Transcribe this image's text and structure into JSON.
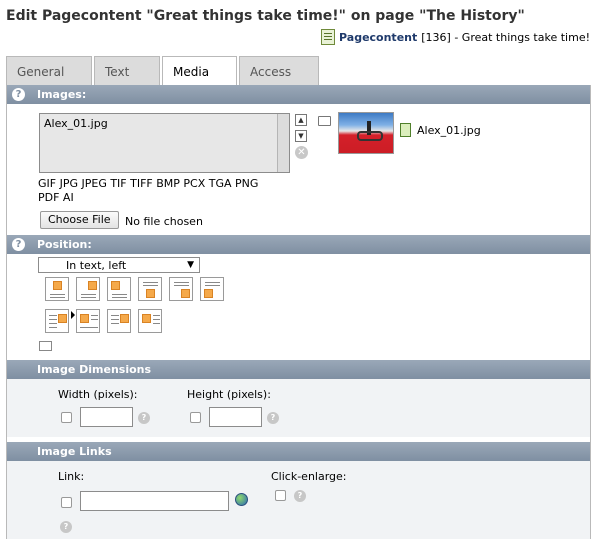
{
  "header": {
    "title": "Edit Pagecontent \"Great things take time!\" on page \"The History\"",
    "record_type": "Pagecontent",
    "record_rest": "[136] - Great things take time!"
  },
  "tabs": [
    "General",
    "Text",
    "Media",
    "Access"
  ],
  "active_tab": "Media",
  "images": {
    "header": "Images:",
    "file_list_item": "Alex_01.jpg",
    "file_name": "Alex_01.jpg",
    "extensions_line1": "GIF JPG JPEG TIF TIFF BMP PCX TGA PNG",
    "extensions_line2": "PDF AI",
    "choose_file_label": "Choose File",
    "no_file_label": "No file chosen"
  },
  "position": {
    "header": "Position:",
    "selected": "In text, left"
  },
  "dimensions": {
    "header": "Image Dimensions",
    "width_label": "Width (pixels):",
    "height_label": "Height (pixels):"
  },
  "links": {
    "header": "Image Links",
    "link_label": "Link:",
    "click_enlarge_label": "Click-enlarge:"
  },
  "icons": {
    "help": "help-icon",
    "folder": "folder-icon",
    "remove": "remove-icon",
    "record": "pagecontent-icon",
    "link_browser": "link-browser-icon"
  },
  "colors": {
    "section_header": "#8a99ab",
    "section_bg": "#f1f3f5",
    "accent_orange": "#f5a94a",
    "record_link": "#1f3a6b"
  }
}
